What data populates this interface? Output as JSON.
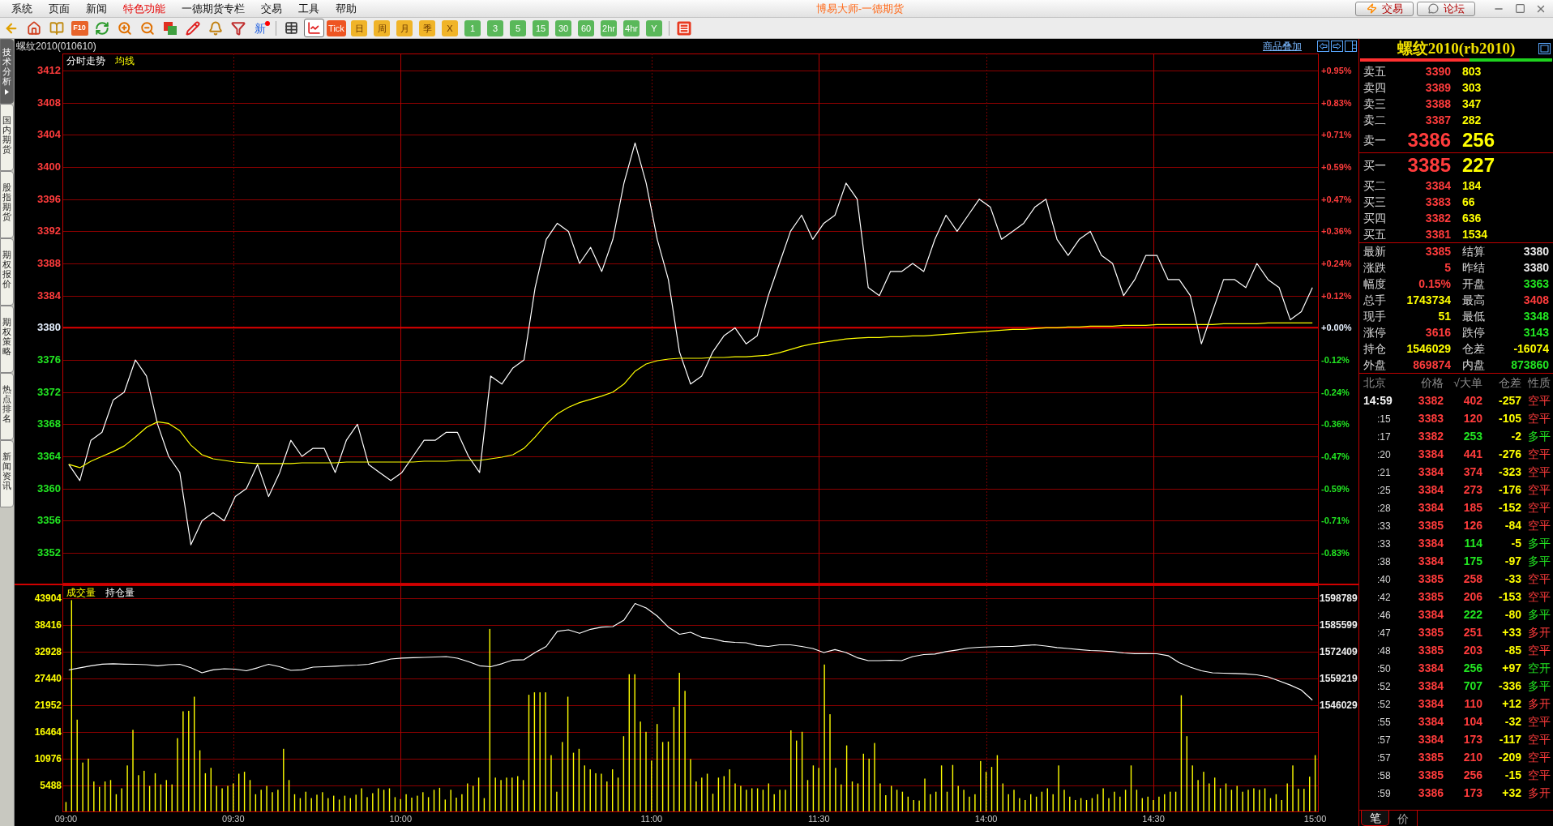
{
  "window": {
    "title": "博易大师-一德期货"
  },
  "menu": [
    {
      "label": "系统",
      "highlighted": false
    },
    {
      "label": "页面",
      "highlighted": false
    },
    {
      "label": "新闻",
      "highlighted": false
    },
    {
      "label": "特色功能",
      "highlighted": true
    },
    {
      "label": "一德期货专栏",
      "highlighted": false
    },
    {
      "label": "交易",
      "highlighted": false
    },
    {
      "label": "工具",
      "highlighted": false
    },
    {
      "label": "帮助",
      "highlighted": false
    }
  ],
  "header_buttons": [
    {
      "label": "交易",
      "kind": "trade"
    },
    {
      "label": "论坛",
      "kind": "forum"
    }
  ],
  "toolbar": {
    "f10_label": "F10",
    "news_label": "新",
    "view_buttons": [
      {
        "kind": "table",
        "selected": false
      },
      {
        "kind": "chart",
        "selected": true
      }
    ],
    "periods": [
      {
        "label": "Tick",
        "kind": "tick"
      },
      {
        "label": "日",
        "kind": "cycle"
      },
      {
        "label": "周",
        "kind": "cycle"
      },
      {
        "label": "月",
        "kind": "cycle"
      },
      {
        "label": "季",
        "kind": "cycle"
      },
      {
        "label": "X",
        "kind": "cycle"
      },
      {
        "label": "1",
        "kind": "minute"
      },
      {
        "label": "3",
        "kind": "minute"
      },
      {
        "label": "5",
        "kind": "minute"
      },
      {
        "label": "15",
        "kind": "minute"
      },
      {
        "label": "30",
        "kind": "minute"
      },
      {
        "label": "60",
        "kind": "minute"
      },
      {
        "label": "2hr",
        "kind": "minute"
      },
      {
        "label": "4hr",
        "kind": "minute"
      },
      {
        "label": "Y",
        "kind": "minute"
      }
    ]
  },
  "side_tabs": [
    {
      "label": "技术分析",
      "selected": true
    },
    {
      "label": "国内期货",
      "selected": false
    },
    {
      "label": "股指期货",
      "selected": false
    },
    {
      "label": "期权报价",
      "selected": false
    },
    {
      "label": "期权策略",
      "selected": false
    },
    {
      "label": "热点排名",
      "selected": false
    },
    {
      "label": "新闻资讯",
      "selected": false
    }
  ],
  "chart_header": {
    "symbol": "螺纹2010(010610)",
    "overlay_link": "商品叠加"
  },
  "price_chart": {
    "chart_data": {
      "type": "line",
      "categories": [
        null,
        null,
        null,
        null,
        null,
        null,
        null,
        null,
        null,
        null,
        null,
        null,
        null,
        null,
        null,
        null,
        null,
        null,
        null,
        null,
        null,
        null,
        null,
        null,
        null,
        null,
        null,
        null,
        null,
        null,
        null,
        null,
        null,
        null,
        null,
        null,
        null,
        null,
        null,
        null,
        null,
        null,
        null,
        null,
        null,
        null,
        null,
        null,
        null,
        null,
        null,
        null,
        null,
        null,
        null,
        null,
        null,
        null,
        null,
        null,
        null,
        null,
        null,
        null,
        null,
        null,
        null,
        null,
        null,
        null,
        null,
        null,
        null,
        null,
        null,
        null,
        null,
        null,
        null,
        null,
        null,
        null,
        null,
        null,
        null,
        null,
        null,
        null,
        null,
        null,
        null,
        null,
        null,
        null,
        null,
        null,
        null,
        null,
        null,
        null,
        null,
        null,
        null,
        null,
        null,
        null,
        null,
        null,
        null,
        null,
        null,
        null,
        null
      ],
      "series": [
        {
          "name": "分时走势",
          "color": "#ffffff",
          "values": [
            3363,
            3361,
            3366,
            3367,
            3371,
            3372,
            3376,
            3374,
            3368,
            3364,
            3362,
            3353,
            3356,
            3357,
            3356,
            3359,
            3360,
            3363,
            3359,
            3362,
            3366,
            3364,
            3365,
            3365,
            3362,
            3366,
            3368,
            3363,
            3362,
            3361,
            3362,
            3364,
            3366,
            3366,
            3367,
            3367,
            3364,
            3362,
            3374,
            3373,
            3375,
            3376,
            3385,
            3391,
            3393,
            3392,
            3388,
            3390,
            3387,
            3391,
            3398,
            3403,
            3398,
            3391,
            3386,
            3377,
            3373,
            3374,
            3377,
            3379,
            3380,
            3378,
            3379,
            3384,
            3388,
            3392,
            3394,
            3391,
            3393,
            3394,
            3398,
            3396,
            3385,
            3384,
            3387,
            3387,
            3388,
            3387,
            3391,
            3394,
            3392,
            3394,
            3396,
            3395,
            3391,
            3392,
            3393,
            3395,
            3396,
            3391,
            3389,
            3391,
            3392,
            3389,
            3388,
            3384,
            3386,
            3389,
            3389,
            3386,
            3386,
            3384,
            3378,
            3382,
            3386,
            3386,
            3385,
            3388,
            3386,
            3385,
            3381,
            3382,
            3385
          ]
        },
        {
          "name": "均线",
          "color": "#ffff00",
          "values": [
            3363.0,
            3362.6,
            3363.4,
            3364.0,
            3364.6,
            3365.3,
            3366.4,
            3367.6,
            3368.3,
            3368.1,
            3367.2,
            3365.4,
            3364.2,
            3363.7,
            3363.5,
            3363.3,
            3363.2,
            3363.1,
            3363.1,
            3363.1,
            3363.1,
            3363.2,
            3363.2,
            3363.2,
            3363.2,
            3363.3,
            3363.3,
            3363.3,
            3363.3,
            3363.3,
            3363.3,
            3363.3,
            3363.4,
            3363.4,
            3363.4,
            3363.5,
            3363.5,
            3363.5,
            3363.7,
            3363.9,
            3364.2,
            3365.0,
            3366.4,
            3368.0,
            3369.3,
            3370.1,
            3370.7,
            3371.1,
            3371.5,
            3372.0,
            3373.0,
            3374.6,
            3375.5,
            3375.9,
            3376.1,
            3376.2,
            3376.2,
            3376.2,
            3376.3,
            3376.3,
            3376.4,
            3376.4,
            3376.5,
            3376.6,
            3376.9,
            3377.3,
            3377.7,
            3378.0,
            3378.2,
            3378.4,
            3378.6,
            3378.7,
            3378.8,
            3378.8,
            3378.9,
            3378.9,
            3379.0,
            3379.0,
            3379.1,
            3379.2,
            3379.3,
            3379.4,
            3379.5,
            3379.6,
            3379.7,
            3379.8,
            3379.8,
            3379.9,
            3380.0,
            3380.0,
            3380.1,
            3380.1,
            3380.2,
            3380.2,
            3380.2,
            3380.3,
            3380.3,
            3380.3,
            3380.4,
            3380.4,
            3380.4,
            3380.4,
            3380.4,
            3380.4,
            3380.5,
            3380.5,
            3380.5,
            3380.5,
            3380.6,
            3380.6,
            3380.6,
            3380.6,
            3380.6
          ]
        }
      ],
      "ylim": [
        3348.17,
        3414.12
      ],
      "yticks": [
        3412,
        3408,
        3404,
        3400,
        3396,
        3392,
        3388,
        3384,
        3380,
        3376,
        3372,
        3368,
        3364,
        3360,
        3356,
        3352
      ],
      "ref_lines": [
        {
          "axis": "y",
          "value": 3380,
          "color": "#e00000"
        }
      ],
      "grid": true
    },
    "percent_axis": [
      "+0.95%",
      "+0.83%",
      "+0.71%",
      "+0.59%",
      "+0.47%",
      "+0.36%",
      "+0.24%",
      "+0.12%",
      "+0.00%",
      "-0.12%",
      "-0.24%",
      "-0.36%",
      "-0.47%",
      "-0.59%",
      "-0.71%",
      "-0.83%"
    ]
  },
  "volume_chart": {
    "chart_data": {
      "type": "bar",
      "categories": [
        "09:00",
        null,
        null,
        null,
        null,
        null,
        null,
        null,
        null,
        null,
        null,
        null,
        null,
        null,
        null,
        null,
        null,
        null,
        null,
        null,
        null,
        null,
        null,
        null,
        null,
        null,
        null,
        null,
        null,
        null,
        "09:30",
        null,
        null,
        null,
        null,
        null,
        null,
        null,
        null,
        null,
        null,
        null,
        null,
        null,
        null,
        null,
        null,
        null,
        null,
        null,
        null,
        null,
        null,
        null,
        null,
        null,
        null,
        null,
        null,
        null,
        "10:00",
        null,
        null,
        null,
        null,
        null,
        null,
        null,
        null,
        null,
        null,
        null,
        null,
        null,
        null,
        null,
        null,
        null,
        null,
        null,
        null,
        null,
        null,
        null,
        null,
        null,
        null,
        null,
        null,
        null,
        null,
        null,
        null,
        null,
        null,
        null,
        null,
        null,
        null,
        null,
        null,
        null,
        null,
        null,
        null,
        "11:00",
        null,
        null,
        null,
        null,
        null,
        null,
        null,
        null,
        null,
        null,
        null,
        null,
        null,
        null,
        null,
        null,
        null,
        null,
        null,
        null,
        null,
        null,
        null,
        null,
        null,
        null,
        null,
        null,
        null,
        "11:30",
        null,
        null,
        null,
        null,
        null,
        null,
        null,
        null,
        null,
        null,
        null,
        null,
        null,
        null,
        null,
        null,
        null,
        null,
        null,
        null,
        null,
        null,
        null,
        null,
        null,
        null,
        null,
        null,
        null,
        "14:00",
        null,
        null,
        null,
        null,
        null,
        null,
        null,
        null,
        null,
        null,
        null,
        null,
        null,
        null,
        null,
        null,
        null,
        null,
        null,
        null,
        null,
        null,
        null,
        null,
        null,
        null,
        null,
        null,
        null,
        "14:30",
        null,
        null,
        null,
        null,
        null,
        null,
        null,
        null,
        null,
        null,
        null,
        null,
        null,
        null,
        null,
        null,
        null,
        null,
        null,
        null,
        null,
        null,
        null,
        null,
        null,
        null,
        null,
        null,
        "15:00"
      ],
      "series": [
        {
          "name": "成交量",
          "color": "#ffff00",
          "values": [
            2100,
            43500,
            19000,
            10200,
            11000,
            6300,
            5200,
            6300,
            6600,
            3700,
            4900,
            9600,
            16900,
            7600,
            8500,
            5400,
            8000,
            5700,
            6600,
            5700,
            15200,
            20700,
            20800,
            23700,
            12700,
            8000,
            9100,
            5400,
            4900,
            5400,
            5900,
            7900,
            8300,
            6600,
            3700,
            4600,
            5400,
            4100,
            4600,
            13000,
            6600,
            3700,
            2900,
            4200,
            2900,
            3600,
            4100,
            2900,
            3400,
            2600,
            3400,
            2900,
            3600,
            4900,
            3100,
            3900,
            4900,
            4600,
            4900,
            3100,
            2700,
            3700,
            3000,
            3400,
            4100,
            3100,
            4600,
            5000,
            2600,
            4600,
            3000,
            3700,
            5900,
            5400,
            7100,
            2900,
            37600,
            7100,
            6600,
            7100,
            7100,
            7400,
            6600,
            24100,
            24600,
            24600,
            24600,
            11700,
            4200,
            14400,
            23700,
            12200,
            13000,
            9600,
            8800,
            8000,
            7900,
            6300,
            8800,
            7100,
            15600,
            28300,
            28300,
            18600,
            16500,
            10600,
            18100,
            14400,
            14500,
            21600,
            28600,
            24900,
            10900,
            6300,
            7100,
            7900,
            3800,
            7100,
            7400,
            8800,
            5900,
            5400,
            4600,
            4900,
            4900,
            4600,
            5900,
            3700,
            4600,
            4600,
            16800,
            14700,
            16500,
            6600,
            9600,
            9100,
            30300,
            20100,
            9100,
            5700,
            13700,
            6300,
            5900,
            12000,
            11000,
            14200,
            5900,
            3500,
            5400,
            4600,
            4200,
            3200,
            2500,
            2400,
            6900,
            3700,
            4200,
            9600,
            4200,
            9700,
            5400,
            4600,
            3200,
            3700,
            10500,
            8300,
            9300,
            11700,
            5900,
            3700,
            4600,
            2900,
            2500,
            3700,
            3200,
            4200,
            4900,
            3700,
            9600,
            4600,
            3200,
            2500,
            2900,
            2500,
            2900,
            3700,
            4900,
            2900,
            4200,
            3200,
            4600,
            9600,
            4600,
            2900,
            3200,
            2500,
            3200,
            3700,
            4200,
            4200,
            24000,
            15600,
            9600,
            6600,
            8300,
            5900,
            7100,
            4900,
            5900,
            4600,
            5400,
            4200,
            4600,
            4900,
            4600,
            4900,
            2900,
            3700,
            2500,
            5900,
            9600,
            4800,
            4800,
            7300,
            11700
          ]
        }
      ],
      "ylim": [
        0,
        46565
      ],
      "yticks": [
        43904,
        38416,
        32928,
        27440,
        21952,
        16464,
        10976,
        5488
      ],
      "grid": true
    }
  },
  "open_interest": {
    "chart_data": {
      "type": "line",
      "categories": [
        null,
        null,
        null,
        null,
        null,
        null,
        null,
        null,
        null,
        null,
        null,
        null,
        null,
        null,
        null,
        null,
        null,
        null,
        null,
        null,
        null,
        null,
        null,
        null,
        null,
        null,
        null,
        null,
        null,
        null,
        null,
        null,
        null,
        null,
        null,
        null,
        null,
        null,
        null,
        null,
        null,
        null,
        null,
        null,
        null,
        null,
        null,
        null,
        null,
        null,
        null,
        null,
        null,
        null,
        null,
        null,
        null,
        null,
        null,
        null,
        null,
        null,
        null,
        null,
        null,
        null,
        null,
        null,
        null,
        null,
        null,
        null,
        null,
        null,
        null,
        null,
        null,
        null,
        null,
        null,
        null,
        null,
        null,
        null,
        null,
        null,
        null,
        null,
        null,
        null,
        null,
        null,
        null,
        null,
        null,
        null,
        null,
        null,
        null,
        null,
        null,
        null,
        null,
        null,
        null,
        null,
        null,
        null,
        null,
        null,
        null,
        null,
        null
      ],
      "series": [
        {
          "name": "持仓量",
          "color": "#ffffff",
          "values": [
            1563400,
            1564500,
            1565500,
            1566300,
            1566500,
            1566300,
            1566200,
            1566000,
            1565500,
            1566000,
            1566200,
            1564500,
            1562000,
            1563500,
            1564000,
            1563800,
            1563000,
            1564500,
            1566200,
            1565000,
            1563200,
            1563500,
            1564800,
            1565000,
            1565300,
            1565600,
            1565800,
            1566200,
            1567500,
            1568800,
            1569300,
            1569500,
            1569600,
            1569800,
            1570000,
            1569200,
            1567500,
            1565500,
            1565000,
            1566500,
            1568300,
            1568500,
            1572000,
            1575000,
            1582500,
            1583200,
            1581500,
            1583500,
            1584500,
            1584800,
            1588000,
            1596200,
            1594000,
            1590000,
            1584500,
            1581000,
            1582000,
            1579500,
            1578800,
            1577500,
            1577000,
            1576800,
            1575500,
            1575000,
            1575800,
            1575800,
            1575000,
            1574000,
            1572000,
            1573500,
            1572000,
            1569500,
            1568000,
            1568000,
            1568200,
            1568000,
            1570000,
            1571000,
            1571300,
            1572500,
            1573300,
            1574200,
            1574600,
            1574800,
            1575000,
            1575000,
            1575500,
            1575800,
            1575200,
            1574500,
            1574000,
            1573500,
            1573000,
            1572800,
            1572500,
            1571800,
            1571500,
            1571500,
            1571400,
            1570500,
            1567000,
            1564800,
            1563000,
            1562000,
            1561800,
            1561700,
            1561500,
            1561000,
            1560000,
            1558000,
            1556000,
            1553500,
            1548500
          ]
        }
      ],
      "ylim": [
        1493268,
        1605184
      ],
      "yticks": [
        1598789,
        1585599,
        1572409,
        1559219,
        1546029
      ]
    }
  },
  "quote": {
    "title": "螺纹2010(rb2010)",
    "ratio_bar": {
      "level": 0.57
    },
    "asks": [
      {
        "label": "卖五",
        "price": "3390",
        "volume": "803",
        "kind": "level"
      },
      {
        "label": "卖四",
        "price": "3389",
        "volume": "303",
        "kind": "level"
      },
      {
        "label": "卖三",
        "price": "3388",
        "volume": "347",
        "kind": "level"
      },
      {
        "label": "卖二",
        "price": "3387",
        "volume": "282",
        "kind": "level"
      },
      {
        "label": "卖一",
        "price": "3386",
        "volume": "256",
        "kind": "best"
      }
    ],
    "bids": [
      {
        "label": "买一",
        "price": "3385",
        "volume": "227",
        "kind": "best"
      },
      {
        "label": "买二",
        "price": "3384",
        "volume": "184",
        "kind": "level"
      },
      {
        "label": "买三",
        "price": "3383",
        "volume": "66",
        "kind": "level"
      },
      {
        "label": "买四",
        "price": "3382",
        "volume": "636",
        "kind": "level"
      },
      {
        "label": "买五",
        "price": "3381",
        "volume": "1534",
        "kind": "level"
      }
    ],
    "stats": [
      {
        "cells": [
          {
            "label": "最新",
            "value": "3385",
            "color": "#ff3c3c"
          },
          {
            "label": "结算",
            "value": "3380",
            "color": "#e8e8e8"
          }
        ]
      },
      {
        "cells": [
          {
            "label": "涨跌",
            "value": "5",
            "color": "#ff3c3c"
          },
          {
            "label": "昨结",
            "value": "3380",
            "color": "#e8e8e8"
          }
        ]
      },
      {
        "cells": [
          {
            "label": "幅度",
            "value": "0.15%",
            "color": "#ff3c3c"
          },
          {
            "label": "开盘",
            "value": "3363",
            "color": "#22e622"
          }
        ]
      },
      {
        "cells": [
          {
            "label": "总手",
            "value": "1743734",
            "color": "#ffff00"
          },
          {
            "label": "最高",
            "value": "3408",
            "color": "#ff3c3c"
          }
        ]
      },
      {
        "cells": [
          {
            "label": "现手",
            "value": "51",
            "color": "#ffff00"
          },
          {
            "label": "最低",
            "value": "3348",
            "color": "#22e622"
          }
        ]
      },
      {
        "cells": [
          {
            "label": "涨停",
            "value": "3616",
            "color": "#ff3c3c"
          },
          {
            "label": "跌停",
            "value": "3143",
            "color": "#22e622"
          }
        ]
      },
      {
        "cells": [
          {
            "label": "持仓",
            "value": "1546029",
            "color": "#ffff00"
          },
          {
            "label": "仓差",
            "value": "-16074",
            "color": "#ffff00"
          }
        ]
      },
      {
        "cells": [
          {
            "label": "外盘",
            "value": "869874",
            "color": "#ff3c3c"
          },
          {
            "label": "内盘",
            "value": "873860",
            "color": "#22e622"
          }
        ]
      }
    ]
  },
  "trades": {
    "columns": [
      "北京",
      "价格",
      "√大单",
      "仓差",
      "性质"
    ],
    "rows": [
      {
        "time": "14:59",
        "kind": "minute",
        "price": "3382",
        "volume": "402",
        "oi_change": "-257",
        "nature": "空平",
        "color": "#ff3c3c"
      },
      {
        "time": ":15",
        "kind": "second",
        "price": "3383",
        "volume": "120",
        "oi_change": "-105",
        "nature": "空平",
        "color": "#ff3c3c"
      },
      {
        "time": ":17",
        "kind": "second",
        "price": "3382",
        "volume": "253",
        "oi_change": "-2",
        "nature": "多平",
        "color": "#22e622"
      },
      {
        "time": ":20",
        "kind": "second",
        "price": "3384",
        "volume": "441",
        "oi_change": "-276",
        "nature": "空平",
        "color": "#ff3c3c"
      },
      {
        "time": ":21",
        "kind": "second",
        "price": "3384",
        "volume": "374",
        "oi_change": "-323",
        "nature": "空平",
        "color": "#ff3c3c"
      },
      {
        "time": ":25",
        "kind": "second",
        "price": "3384",
        "volume": "273",
        "oi_change": "-176",
        "nature": "空平",
        "color": "#ff3c3c"
      },
      {
        "time": ":28",
        "kind": "second",
        "price": "3384",
        "volume": "185",
        "oi_change": "-152",
        "nature": "空平",
        "color": "#ff3c3c"
      },
      {
        "time": ":33",
        "kind": "second",
        "price": "3385",
        "volume": "126",
        "oi_change": "-84",
        "nature": "空平",
        "color": "#ff3c3c"
      },
      {
        "time": ":33",
        "kind": "second",
        "price": "3384",
        "volume": "114",
        "oi_change": "-5",
        "nature": "多平",
        "color": "#22e622"
      },
      {
        "time": ":38",
        "kind": "second",
        "price": "3384",
        "volume": "175",
        "oi_change": "-97",
        "nature": "多平",
        "color": "#22e622"
      },
      {
        "time": ":40",
        "kind": "second",
        "price": "3385",
        "volume": "258",
        "oi_change": "-33",
        "nature": "空平",
        "color": "#ff3c3c"
      },
      {
        "time": ":42",
        "kind": "second",
        "price": "3385",
        "volume": "206",
        "oi_change": "-153",
        "nature": "空平",
        "color": "#ff3c3c"
      },
      {
        "time": ":46",
        "kind": "second",
        "price": "3384",
        "volume": "222",
        "oi_change": "-80",
        "nature": "多平",
        "color": "#22e622"
      },
      {
        "time": ":47",
        "kind": "second",
        "price": "3385",
        "volume": "251",
        "oi_change": "+33",
        "nature": "多开",
        "color": "#ff3c3c"
      },
      {
        "time": ":48",
        "kind": "second",
        "price": "3385",
        "volume": "203",
        "oi_change": "-85",
        "nature": "空平",
        "color": "#ff3c3c"
      },
      {
        "time": ":50",
        "kind": "second",
        "price": "3384",
        "volume": "256",
        "oi_change": "+97",
        "nature": "空开",
        "color": "#22e622"
      },
      {
        "time": ":52",
        "kind": "second",
        "price": "3384",
        "volume": "707",
        "oi_change": "-336",
        "nature": "多平",
        "color": "#22e622"
      },
      {
        "time": ":52",
        "kind": "second",
        "price": "3384",
        "volume": "110",
        "oi_change": "+12",
        "nature": "多开",
        "color": "#ff3c3c"
      },
      {
        "time": ":55",
        "kind": "second",
        "price": "3384",
        "volume": "104",
        "oi_change": "-32",
        "nature": "空平",
        "color": "#ff3c3c"
      },
      {
        "time": ":57",
        "kind": "second",
        "price": "3384",
        "volume": "173",
        "oi_change": "-117",
        "nature": "空平",
        "color": "#ff3c3c"
      },
      {
        "time": ":57",
        "kind": "second",
        "price": "3385",
        "volume": "210",
        "oi_change": "-209",
        "nature": "空平",
        "color": "#ff3c3c"
      },
      {
        "time": ":58",
        "kind": "second",
        "price": "3385",
        "volume": "256",
        "oi_change": "-15",
        "nature": "空平",
        "color": "#ff3c3c"
      },
      {
        "time": ":59",
        "kind": "second",
        "price": "3386",
        "volume": "173",
        "oi_change": "+32",
        "nature": "多开",
        "color": "#ff3c3c"
      }
    ],
    "tabs": [
      {
        "label": "笔",
        "selected": true
      },
      {
        "label": "价",
        "selected": false
      }
    ]
  }
}
